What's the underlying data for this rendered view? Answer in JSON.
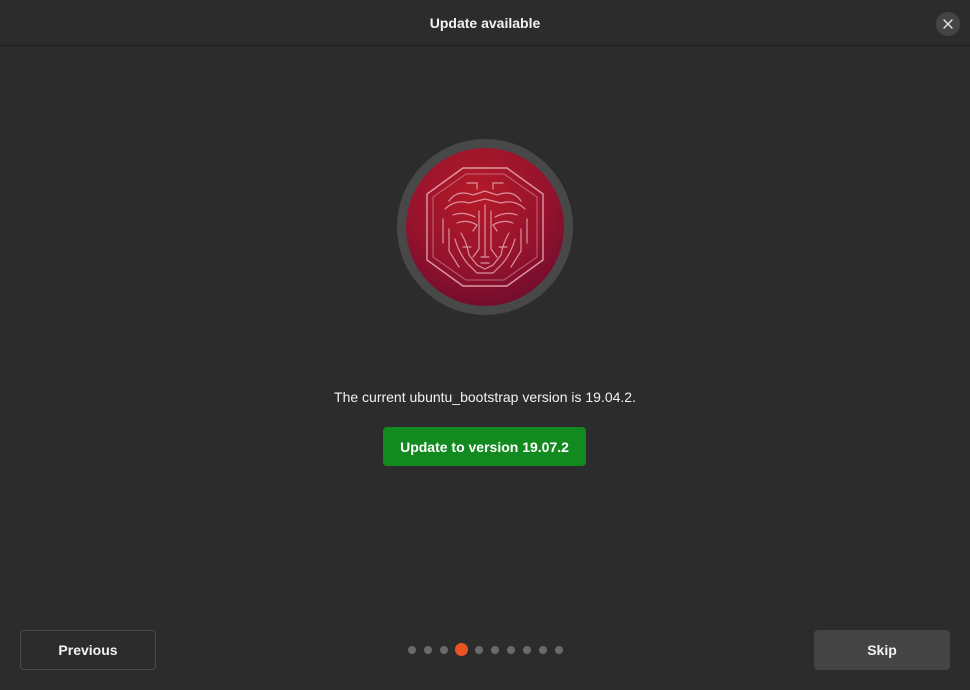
{
  "header": {
    "title": "Update available",
    "close_icon": "close-icon"
  },
  "logo": {
    "icon": "ubuntu-mascot-logo-icon",
    "ring_color": "#484848",
    "fill_top": "#b51a28",
    "fill_bottom": "#6e0b2e"
  },
  "main": {
    "message": "The current ubuntu_bootstrap version is 19.04.2.",
    "update_button_label": "Update to version 19.07.2",
    "update_button_color": "#138a1f"
  },
  "footer": {
    "previous_label": "Previous",
    "skip_label": "Skip",
    "pagination": {
      "total": 10,
      "current": 4,
      "active_color": "#e95420"
    }
  }
}
